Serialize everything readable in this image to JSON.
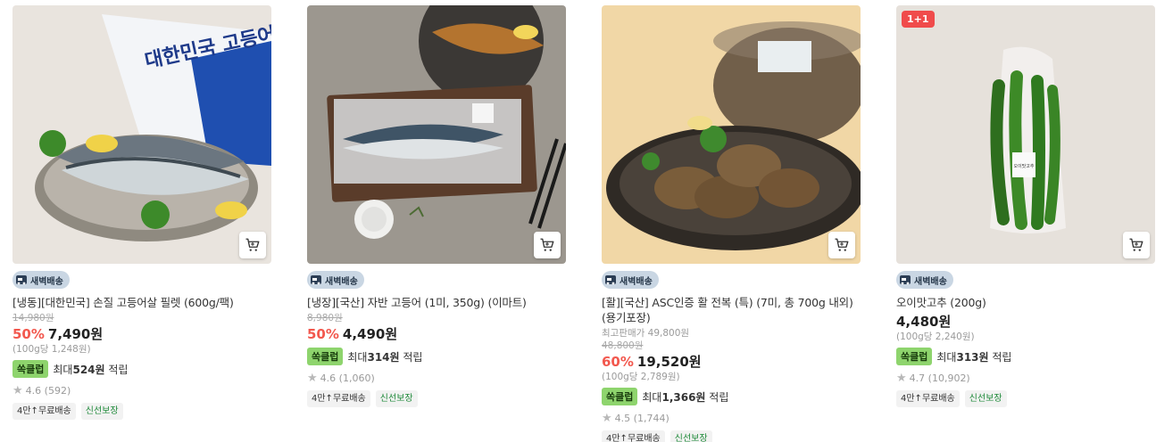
{
  "products": [
    {
      "title": "[냉동][대한민국] 손질 고등어살 필렛 (600g/팩)",
      "delivery_badge": "새벽배송",
      "original_price": "14,980원",
      "discount": "50%",
      "price": "7,490원",
      "unit_price": "(100g당 1,248원)",
      "points_label": "쏙클럽",
      "points_prefix": "최대",
      "points_amount": "524원",
      "points_suffix": "적립",
      "rating": "4.6",
      "review_count": "(592)",
      "tags": [
        "4만↑무료배송",
        "신선보장"
      ],
      "package_text": "대한민국 고등어살"
    },
    {
      "title": "[냉장][국산] 자반 고등어 (1미, 350g) (이마트)",
      "delivery_badge": "새벽배송",
      "original_price": "8,980원",
      "discount": "50%",
      "price": "4,490원",
      "points_label": "쏙클럽",
      "points_prefix": "최대",
      "points_amount": "314원",
      "points_suffix": "적립",
      "rating": "4.6",
      "review_count": "(1,060)",
      "tags": [
        "4만↑무료배송",
        "신선보장"
      ]
    },
    {
      "title": "[활][국산] ASC인증 활 전복 (특) (7미, 총 700g 내외) (용기포장)",
      "delivery_badge": "새벽배송",
      "max_price": "최고판매가 49,800원",
      "original_price": "48,800원",
      "discount": "60%",
      "price": "19,520원",
      "unit_price": "(100g당 2,789원)",
      "points_label": "쏙클럽",
      "points_prefix": "최대",
      "points_amount": "1,366원",
      "points_suffix": "적립",
      "rating": "4.5",
      "review_count": "(1,744)",
      "tags": [
        "4만↑무료배송",
        "신선보장"
      ]
    },
    {
      "title": "오이맛고추 (200g)",
      "promo_badge": "1+1",
      "delivery_badge": "새벽배송",
      "price": "4,480원",
      "unit_price": "(100g당 2,240원)",
      "points_label": "쏙클럽",
      "points_prefix": "최대",
      "points_amount": "313원",
      "points_suffix": "적립",
      "rating": "4.7",
      "review_count": "(10,902)",
      "tags": [
        "4만↑무료배송",
        "신선보장"
      ],
      "package_text": "오이맛고추"
    }
  ],
  "icons": {
    "cart": "cart-icon",
    "star": "star-icon",
    "truck": "truck-icon"
  },
  "colors": {
    "discount": "#f2584e",
    "points_chip": "#8ed46d",
    "promo_badge": "#f04b4b",
    "tag_green": "#1f8a3a"
  }
}
